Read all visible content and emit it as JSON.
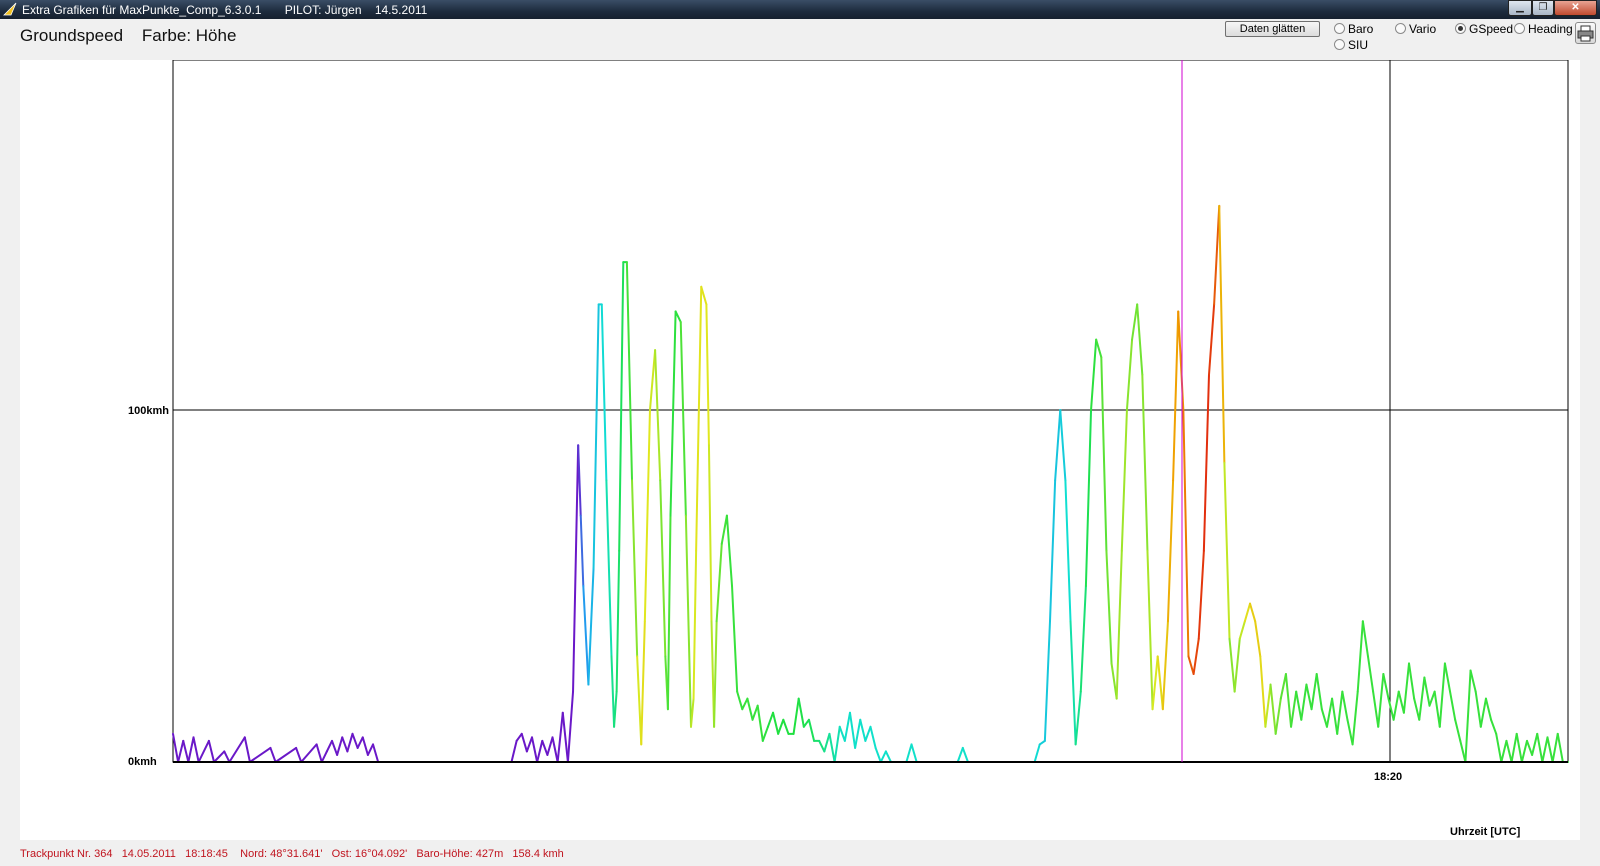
{
  "window": {
    "title": "Extra Grafiken für MaxPunkte_Comp_6.3.0.1       PILOT: Jürgen    14.5.2011",
    "controls": [
      "minimize",
      "maximize",
      "close"
    ]
  },
  "header": {
    "label": "Groundspeed    Farbe: Höhe"
  },
  "toolbar": {
    "smooth_label": "Daten glätten",
    "radios": [
      {
        "label": "Baro",
        "checked": false
      },
      {
        "label": "Vario",
        "checked": false
      },
      {
        "label": "GSpeed",
        "checked": true
      },
      {
        "label": "Heading",
        "checked": false
      },
      {
        "label": "SIU",
        "checked": false
      }
    ],
    "print_icon": "printer-icon"
  },
  "chart_data": {
    "type": "line",
    "title": "",
    "ylabel": "",
    "xlabel": "Uhrzeit [UTC]",
    "y_ticks": [
      {
        "value": 0,
        "label": "0kmh"
      },
      {
        "value": 100,
        "label": "100kmh"
      }
    ],
    "x_ticks": [
      {
        "label": "18:20"
      }
    ],
    "ylim": [
      0,
      200
    ],
    "grid": true,
    "color_encoding": "altitude (purple = low → red = high)",
    "cursor_trackpoint": 364,
    "colors": {
      "cursor": "#d000d0",
      "gradient": [
        "#6a18c8",
        "#1fa0f0",
        "#10e0d0",
        "#20e040",
        "#e0e820",
        "#f0a000",
        "#e02010"
      ]
    },
    "series": [
      {
        "points": [
          [
            0,
            8,
            0
          ],
          [
            1,
            0,
            0
          ],
          [
            2,
            6,
            0
          ],
          [
            3,
            0,
            0
          ],
          [
            4,
            7,
            0
          ],
          [
            5,
            0,
            0
          ],
          [
            7,
            6,
            0
          ],
          [
            8,
            0,
            0
          ],
          [
            10,
            3,
            0
          ],
          [
            11,
            0,
            0
          ],
          [
            14,
            7,
            0
          ],
          [
            15,
            0,
            0
          ],
          [
            19,
            4,
            0
          ],
          [
            20,
            0,
            0
          ],
          [
            24,
            4,
            0
          ],
          [
            25,
            0,
            0
          ],
          [
            28,
            5,
            0
          ],
          [
            29,
            0,
            0
          ],
          [
            30,
            3,
            0
          ],
          [
            31,
            6,
            0
          ],
          [
            32,
            2,
            0
          ],
          [
            33,
            7,
            0
          ],
          [
            34,
            3,
            0
          ],
          [
            35,
            8,
            0
          ],
          [
            36,
            4,
            0
          ],
          [
            37,
            7,
            0
          ],
          [
            38,
            2,
            0
          ],
          [
            39,
            5,
            0
          ],
          [
            40,
            0,
            0
          ],
          [
            60,
            0,
            0
          ],
          [
            66,
            0,
            0
          ],
          [
            67,
            6,
            0
          ],
          [
            68,
            8,
            0
          ],
          [
            69,
            3,
            0
          ],
          [
            70,
            7,
            0
          ],
          [
            71,
            0,
            0
          ],
          [
            72,
            6,
            0
          ],
          [
            73,
            2,
            0
          ],
          [
            74,
            7,
            0
          ],
          [
            75,
            0,
            0
          ],
          [
            76,
            14,
            0
          ],
          [
            77,
            0,
            0
          ],
          [
            78,
            20,
            0
          ],
          [
            79,
            90,
            0
          ],
          [
            79.5,
            70,
            0.08
          ],
          [
            80,
            50,
            0.12
          ],
          [
            81,
            22,
            0.2
          ],
          [
            82,
            55,
            0.24
          ],
          [
            83,
            130,
            0.28
          ],
          [
            83.6,
            130,
            0.3
          ],
          [
            84.5,
            80,
            0.34
          ],
          [
            85.5,
            30,
            0.4
          ],
          [
            86,
            10,
            0.42
          ],
          [
            86.5,
            20,
            0.44
          ],
          [
            87,
            60,
            0.46
          ],
          [
            87.8,
            142,
            0.48
          ],
          [
            88.5,
            142,
            0.5
          ],
          [
            89.5,
            80,
            0.56
          ],
          [
            90.5,
            30,
            0.62
          ],
          [
            91.3,
            5,
            0.7
          ],
          [
            92,
            40,
            0.68
          ],
          [
            93,
            100,
            0.66
          ],
          [
            94,
            117,
            0.64
          ],
          [
            95,
            80,
            0.6
          ],
          [
            96,
            30,
            0.56
          ],
          [
            96.5,
            15,
            0.55
          ],
          [
            97,
            70,
            0.52
          ],
          [
            98,
            128,
            0.5
          ],
          [
            99,
            125,
            0.52
          ],
          [
            100,
            70,
            0.56
          ],
          [
            101,
            10,
            0.62
          ],
          [
            101.5,
            18,
            0.65
          ],
          [
            102,
            60,
            0.67
          ],
          [
            103,
            135,
            0.68
          ],
          [
            104,
            130,
            0.68
          ],
          [
            104.5,
            90,
            0.66
          ],
          [
            105,
            40,
            0.64
          ],
          [
            105.5,
            10,
            0.62
          ],
          [
            106,
            40,
            0.58
          ],
          [
            107,
            62,
            0.54
          ],
          [
            108,
            70,
            0.52
          ],
          [
            109,
            50,
            0.52
          ],
          [
            110,
            20,
            0.52
          ],
          [
            111,
            15,
            0.52
          ],
          [
            112,
            18,
            0.52
          ],
          [
            113,
            12,
            0.52
          ],
          [
            114,
            16,
            0.52
          ],
          [
            115,
            6,
            0.52
          ],
          [
            116,
            10,
            0.5
          ],
          [
            117,
            14,
            0.5
          ],
          [
            118,
            8,
            0.5
          ],
          [
            119,
            12,
            0.5
          ],
          [
            120,
            8,
            0.5
          ],
          [
            121,
            8,
            0.5
          ],
          [
            122,
            18,
            0.5
          ],
          [
            123,
            10,
            0.48
          ],
          [
            124,
            12,
            0.48
          ],
          [
            125,
            6,
            0.46
          ],
          [
            126,
            6,
            0.44
          ],
          [
            127,
            3,
            0.42
          ],
          [
            128,
            8,
            0.4
          ],
          [
            129,
            0,
            0.38
          ],
          [
            130,
            10,
            0.36
          ],
          [
            131,
            6,
            0.34
          ],
          [
            132,
            14,
            0.34
          ],
          [
            133,
            4,
            0.34
          ],
          [
            134,
            12,
            0.34
          ],
          [
            135,
            6,
            0.34
          ],
          [
            136,
            10,
            0.34
          ],
          [
            137,
            4,
            0.34
          ],
          [
            138,
            0,
            0.34
          ],
          [
            139,
            3,
            0.34
          ],
          [
            140,
            0,
            0.34
          ],
          [
            143,
            0,
            0.34
          ],
          [
            144,
            5,
            0.34
          ],
          [
            145,
            0,
            0.34
          ],
          [
            153,
            0,
            0.34
          ],
          [
            154,
            4,
            0.34
          ],
          [
            155,
            0,
            0.34
          ],
          [
            168,
            0,
            0.34
          ],
          [
            169,
            5,
            0.3
          ],
          [
            170,
            6,
            0.28
          ],
          [
            171,
            40,
            0.26
          ],
          [
            172,
            80,
            0.26
          ],
          [
            173,
            100,
            0.26
          ],
          [
            174,
            80,
            0.3
          ],
          [
            175,
            40,
            0.36
          ],
          [
            176,
            5,
            0.4
          ],
          [
            177,
            20,
            0.42
          ],
          [
            178,
            50,
            0.46
          ],
          [
            179,
            100,
            0.5
          ],
          [
            180,
            120,
            0.52
          ],
          [
            181,
            115,
            0.54
          ],
          [
            182,
            60,
            0.56
          ],
          [
            183,
            28,
            0.58
          ],
          [
            184,
            18,
            0.6
          ],
          [
            185,
            60,
            0.62
          ],
          [
            186,
            100,
            0.6
          ],
          [
            187,
            120,
            0.58
          ],
          [
            188,
            130,
            0.56
          ],
          [
            189,
            110,
            0.58
          ],
          [
            190,
            60,
            0.6
          ],
          [
            191,
            15,
            0.64
          ],
          [
            192,
            30,
            0.68
          ],
          [
            193,
            15,
            0.72
          ],
          [
            194,
            40,
            0.78
          ],
          [
            195,
            80,
            0.82
          ],
          [
            196,
            128,
            0.84
          ],
          [
            197,
            100,
            0.86
          ],
          [
            198,
            30,
            0.9
          ],
          [
            199,
            25,
            0.94
          ],
          [
            200,
            35,
            0.96
          ],
          [
            201,
            60,
            0.98
          ],
          [
            202,
            110,
            0.98
          ],
          [
            203,
            130,
            0.95
          ],
          [
            204,
            158,
            0.9
          ],
          [
            205,
            85,
            0.68
          ],
          [
            206,
            35,
            0.6
          ],
          [
            207,
            20,
            0.58
          ],
          [
            208,
            35,
            0.62
          ],
          [
            209,
            40,
            0.66
          ],
          [
            210,
            45,
            0.72
          ],
          [
            211,
            40,
            0.74
          ],
          [
            212,
            30,
            0.72
          ],
          [
            213,
            10,
            0.68
          ],
          [
            214,
            22,
            0.6
          ],
          [
            215,
            8,
            0.58
          ],
          [
            216,
            18,
            0.56
          ],
          [
            217,
            25,
            0.54
          ],
          [
            218,
            10,
            0.54
          ],
          [
            219,
            20,
            0.52
          ],
          [
            220,
            12,
            0.52
          ],
          [
            221,
            22,
            0.52
          ],
          [
            222,
            15,
            0.52
          ],
          [
            223,
            25,
            0.52
          ],
          [
            224,
            15,
            0.52
          ],
          [
            225,
            10,
            0.52
          ],
          [
            226,
            18,
            0.52
          ],
          [
            227,
            8,
            0.52
          ],
          [
            228,
            20,
            0.52
          ],
          [
            229,
            12,
            0.52
          ],
          [
            230,
            5,
            0.52
          ],
          [
            231,
            20,
            0.52
          ],
          [
            232,
            40,
            0.52
          ],
          [
            233,
            30,
            0.52
          ],
          [
            234,
            20,
            0.52
          ],
          [
            235,
            10,
            0.52
          ],
          [
            236,
            25,
            0.52
          ],
          [
            237,
            18,
            0.52
          ],
          [
            238,
            12,
            0.52
          ],
          [
            239,
            20,
            0.52
          ],
          [
            240,
            14,
            0.52
          ],
          [
            241,
            28,
            0.52
          ],
          [
            242,
            18,
            0.52
          ],
          [
            243,
            12,
            0.52
          ],
          [
            244,
            24,
            0.52
          ],
          [
            245,
            16,
            0.52
          ],
          [
            246,
            20,
            0.52
          ],
          [
            247,
            10,
            0.52
          ],
          [
            248,
            28,
            0.52
          ],
          [
            249,
            20,
            0.52
          ],
          [
            250,
            12,
            0.52
          ],
          [
            251,
            6,
            0.52
          ],
          [
            252,
            0,
            0.52
          ],
          [
            253,
            26,
            0.52
          ],
          [
            254,
            20,
            0.52
          ],
          [
            255,
            10,
            0.52
          ],
          [
            256,
            18,
            0.52
          ],
          [
            257,
            12,
            0.52
          ],
          [
            258,
            8,
            0.52
          ],
          [
            259,
            0,
            0.52
          ],
          [
            260,
            6,
            0.52
          ],
          [
            261,
            0,
            0.52
          ],
          [
            262,
            8,
            0.52
          ],
          [
            263,
            0,
            0.52
          ],
          [
            264,
            6,
            0.52
          ],
          [
            265,
            2,
            0.52
          ],
          [
            266,
            8,
            0.52
          ],
          [
            267,
            0,
            0.52
          ],
          [
            268,
            7,
            0.52
          ],
          [
            269,
            0,
            0.52
          ],
          [
            270,
            8,
            0.52
          ],
          [
            271,
            0,
            0.52
          ],
          [
            272,
            0,
            0.52
          ]
        ]
      }
    ]
  },
  "status": {
    "text": "Trackpunkt Nr. 364   14.05.2011   18:18:45    Nord: 48°31.641'   Ost: 16°04.092'   Baro-Höhe: 427m   158.4 kmh"
  }
}
